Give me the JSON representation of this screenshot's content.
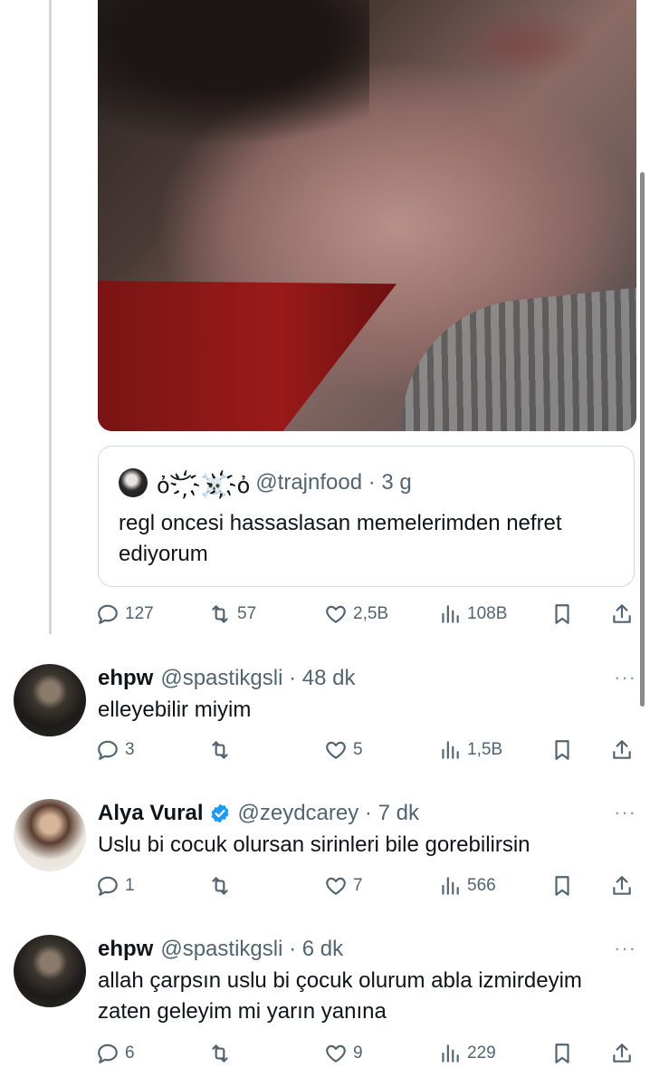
{
  "quoted_tweet": {
    "name": "ὀ︶҉☠️҉ὀ",
    "handle_time": "@trajnfood · 3 g",
    "text": "regl oncesi hassaslasan memelerimden nefret ediyorum"
  },
  "main_actions": {
    "replies": "127",
    "retweets": "57",
    "likes": "2,5B",
    "views": "108B"
  },
  "replies": [
    {
      "name": "ehpw",
      "handle_time": "@spastikgsli · 48 dk",
      "text": "elleyebilir miyim",
      "verified": false,
      "actions": {
        "replies": "3",
        "retweets": "",
        "likes": "5",
        "views": "1,5B"
      }
    },
    {
      "name": "Alya Vural",
      "handle_time": "@zeydcarey · 7 dk",
      "text": "Uslu bi cocuk olursan sirinleri bile gorebilirsin",
      "verified": true,
      "actions": {
        "replies": "1",
        "retweets": "",
        "likes": "7",
        "views": "566"
      }
    },
    {
      "name": "ehpw",
      "handle_time": "@spastikgsli · 6 dk",
      "text": "allah çarpsın uslu bi çocuk olurum abla izmirdeyim zaten geleyim mi yarın yanına",
      "verified": false,
      "actions": {
        "replies": "6",
        "retweets": "",
        "likes": "9",
        "views": "229"
      }
    }
  ],
  "more_label": "···",
  "colors": {
    "text": "#0f1419",
    "secondary": "#536471",
    "verified": "#1d9bf0",
    "border": "#cfd9de"
  },
  "icons": [
    "reply-icon",
    "retweet-icon",
    "like-icon",
    "views-icon",
    "bookmark-icon",
    "share-icon",
    "verified-icon",
    "more-icon"
  ]
}
